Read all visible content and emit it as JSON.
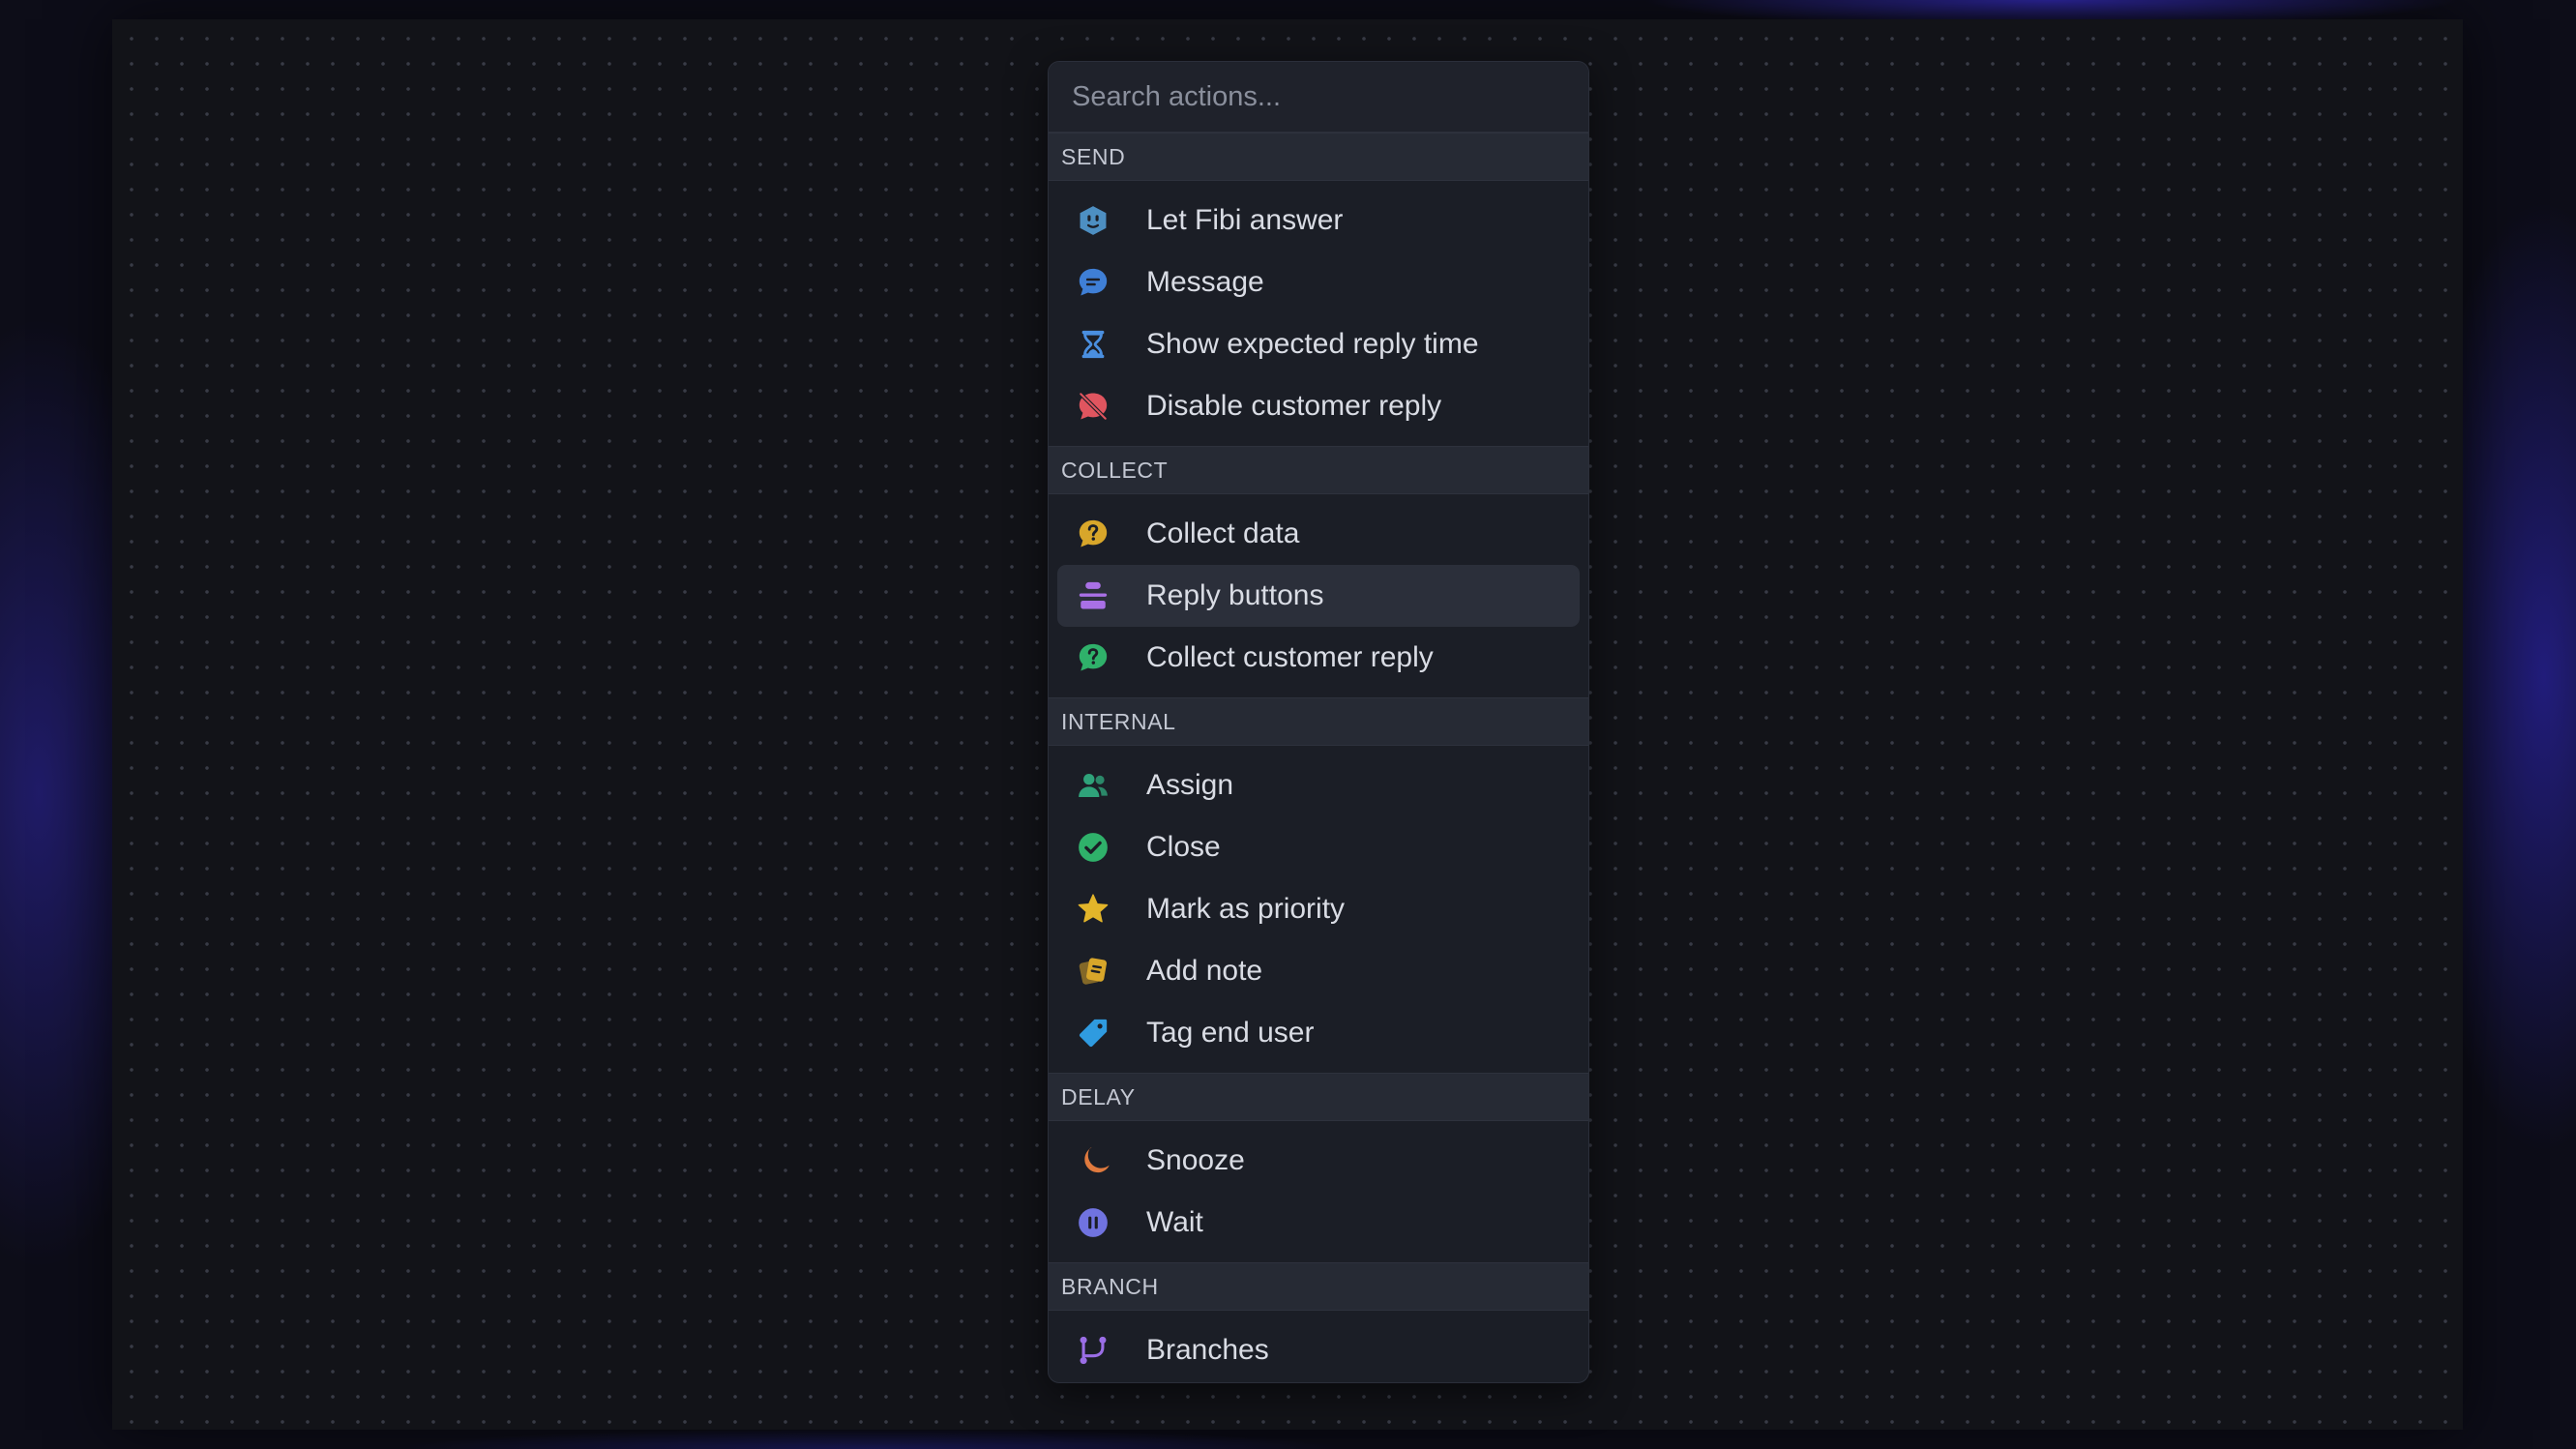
{
  "search": {
    "placeholder": "Search actions..."
  },
  "sections": [
    {
      "title": "SEND",
      "items": [
        {
          "label": "Let Fibi answer",
          "icon": "fibi-bot-icon",
          "color": "#4d8fc2"
        },
        {
          "label": "Message",
          "icon": "chat-bubble-icon",
          "color": "#3f7fd6"
        },
        {
          "label": "Show expected reply time",
          "icon": "hourglass-icon",
          "color": "#4a8fe0"
        },
        {
          "label": "Disable customer reply",
          "icon": "chat-disabled-icon",
          "color": "#e0555f"
        }
      ]
    },
    {
      "title": "COLLECT",
      "items": [
        {
          "label": "Collect data",
          "icon": "question-bubble-icon",
          "color": "#d8a62a"
        },
        {
          "label": "Reply buttons",
          "icon": "reply-buttons-icon",
          "color": "#a970e6",
          "active": true
        },
        {
          "label": "Collect customer reply",
          "icon": "question-bubble-icon",
          "color": "#2fb16a"
        }
      ]
    },
    {
      "title": "INTERNAL",
      "items": [
        {
          "label": "Assign",
          "icon": "users-icon",
          "color": "#2fa37a"
        },
        {
          "label": "Close",
          "icon": "check-circle-icon",
          "color": "#2fb16a"
        },
        {
          "label": "Mark as priority",
          "icon": "star-icon",
          "color": "#e3b52a"
        },
        {
          "label": "Add note",
          "icon": "note-icon",
          "color": "#d8a62a"
        },
        {
          "label": "Tag end user",
          "icon": "tag-icon",
          "color": "#2f9be0"
        }
      ]
    },
    {
      "title": "DELAY",
      "items": [
        {
          "label": "Snooze",
          "icon": "moon-icon",
          "color": "#e07a3e"
        },
        {
          "label": "Wait",
          "icon": "pause-circle-icon",
          "color": "#7073e0"
        }
      ]
    },
    {
      "title": "BRANCH",
      "items": [
        {
          "label": "Branches",
          "icon": "branch-icon",
          "color": "#9b6ee6"
        }
      ]
    }
  ]
}
